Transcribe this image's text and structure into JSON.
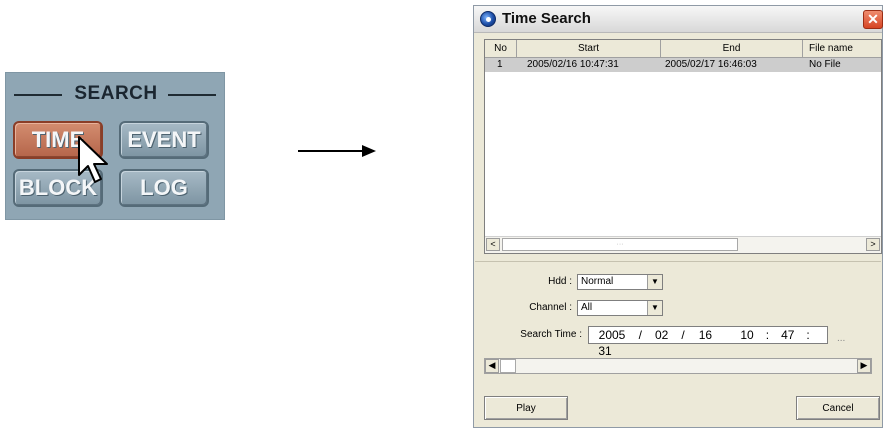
{
  "search_panel": {
    "header": "SEARCH",
    "buttons": {
      "time": "TIME",
      "event": "EVENT",
      "block": "BLOCK",
      "log": "LOG"
    },
    "colors": {
      "panel": "#8fa6b4",
      "active": "#c57658"
    }
  },
  "dialog": {
    "title": "Time Search",
    "close_label": "✕",
    "columns": [
      "No",
      "Start",
      "End",
      "File name"
    ],
    "rows": [
      {
        "no": "1",
        "start": "2005/02/16  10:47:31",
        "end": "2005/02/17  16:46:03",
        "file": "No File"
      }
    ],
    "scroll": {
      "left": "<",
      "right": ">",
      "thumb": "···"
    },
    "hdd": {
      "label": "Hdd :",
      "value": "Normal"
    },
    "channel": {
      "label": "Channel :",
      "value": "All"
    },
    "search_time": {
      "label": "Search Time :",
      "year": "2005",
      "month": "02",
      "day": "16",
      "hour": "10",
      "minute": "47",
      "second": "31",
      "sep_date": "/",
      "sep_time": ":"
    },
    "ellipsis": "...",
    "play_button": "Play",
    "cancel_button": "Cancel"
  }
}
